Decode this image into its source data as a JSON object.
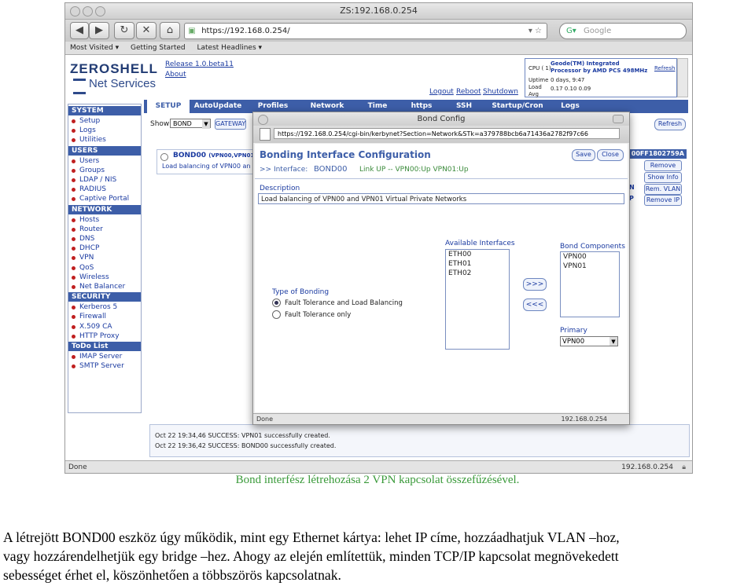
{
  "browser": {
    "window_title": "ZS:192.168.0.254",
    "url": "https://192.168.0.254/",
    "search_placeholder": "Google",
    "bookmarks": [
      "Most Visited ▾",
      "Getting Started",
      "Latest Headlines ▾"
    ],
    "status": "Done",
    "status_host": "192.168.0.254"
  },
  "app": {
    "logo_top": "ZEROSHELL",
    "logo_bottom": "Net Services",
    "release": "Release 1.0.beta11",
    "about": "About",
    "logout": "Logout",
    "reboot": "Reboot",
    "shutdown": "Shutdown",
    "cpu_label": "CPU ( 1)",
    "cpu_value": "Geode(TM) Integrated Processor by AMD PCS 498MHz",
    "uptime_label": "Uptime",
    "uptime_value": "0 days, 9:47",
    "load_label": "Load",
    "load_value": "0.17 0.10 0.09",
    "avg_label": "Avg",
    "refresh_top": "Refresh",
    "tabs": [
      "SETUP",
      "AutoUpdate",
      "Profiles",
      "Network",
      "Time",
      "https",
      "SSH",
      "Startup/Cron",
      "Logs"
    ],
    "show_label": "Show",
    "show_value": "BOND",
    "gateway_btn": "GATEWAY",
    "refresh_btn": "Refresh",
    "bond_name": "BOND00",
    "bond_desc_short": "(VPN00,VPN01)",
    "bond_desc": "Load balancing of VPN00 an",
    "bond_mac": "00FF1802759A",
    "right_buttons": [
      "Remove",
      "Show Info",
      "Rem. VLAN",
      "Remove IP"
    ],
    "right_prefix": [
      "N",
      "P"
    ],
    "sidebar": [
      {
        "header": "SYSTEM",
        "items": [
          "Setup",
          "Logs",
          "Utilities"
        ]
      },
      {
        "header": "USERS",
        "items": [
          "Users",
          "Groups",
          "LDAP / NIS",
          "RADIUS",
          "Captive Portal"
        ]
      },
      {
        "header": "NETWORK",
        "items": [
          "Hosts",
          "Router",
          "DNS",
          "DHCP",
          "VPN",
          "QoS",
          "Wireless",
          "Net Balancer"
        ]
      },
      {
        "header": "SECURITY",
        "items": [
          "Kerberos 5",
          "Firewall",
          "X.509 CA",
          "HTTP Proxy"
        ]
      },
      {
        "header": "ToDo List",
        "items": [
          "IMAP Server",
          "SMTP Server"
        ]
      }
    ],
    "log_lines": [
      "Oct 22 19:34,46 SUCCESS: VPN01 successfully created.",
      "Oct 22 19:36,42 SUCCESS: BOND00 successfully created."
    ]
  },
  "popup": {
    "title": "Bond Config",
    "url": "https://192.168.0.254/cgi-bin/kerbynet?Section=Network&STk=a379788bcb6a71436a2782f97c66",
    "heading": "Bonding Interface Configuration",
    "interface_label": ">> Interface:",
    "interface_value": "BOND00",
    "link_status": "Link UP -- VPN00:Up VPN01:Up",
    "save": "Save",
    "close": "Close",
    "description_label": "Description",
    "description_value": "Load balancing of VPN00 and VPN01 Virtual Private Networks",
    "available_label": "Available Interfaces",
    "available": [
      "ETH00",
      "ETH01",
      "ETH02"
    ],
    "components_label": "Bond Components",
    "components": [
      "VPN00",
      "VPN01"
    ],
    "add_btn": ">>>",
    "remove_btn": "<<<",
    "type_label": "Type of Bonding",
    "type_options": [
      "Fault Tolerance and Load Balancing",
      "Fault Tolerance only"
    ],
    "type_selected": 0,
    "primary_label": "Primary",
    "primary_value": "VPN00",
    "status": "Done",
    "status_host": "192.168.0.254"
  },
  "caption": "Bond interfész létrehozása 2 VPN kapcsolat összefűzésével.",
  "paragraph": [
    "A létrejött BOND00 eszköz úgy működik, mint egy Ethernet kártya: lehet IP címe, hozzáadhatjuk VLAN –hoz,",
    "vagy hozzárendelhetjük egy bridge –hez. Ahogy az elején említettük, minden TCP/IP kapcsolat megnövekedett",
    "sebességet érhet el, köszönhetően a többszörös kapcsolatnak."
  ]
}
